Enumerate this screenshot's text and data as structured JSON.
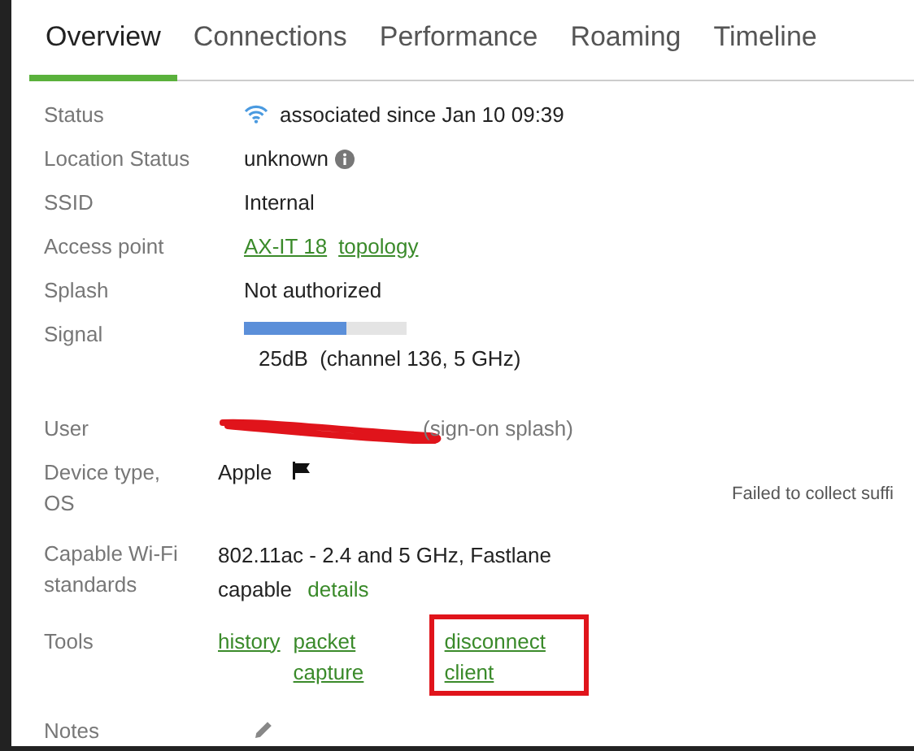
{
  "tabs": [
    {
      "label": "Overview",
      "selected": true
    },
    {
      "label": "Connections",
      "selected": false
    },
    {
      "label": "Performance",
      "selected": false
    },
    {
      "label": "Roaming",
      "selected": false
    },
    {
      "label": "Timeline",
      "selected": false
    }
  ],
  "rows": [
    {
      "kind": "status",
      "label": "Status",
      "value": "associated since Jan 10 09:39"
    },
    {
      "kind": "info",
      "label": "Location Status",
      "value": "unknown"
    },
    {
      "kind": "text",
      "label": "SSID",
      "value": "Internal"
    },
    {
      "kind": "links",
      "label": "Access point",
      "links": [
        "AX-IT 18",
        "topology"
      ]
    },
    {
      "kind": "text",
      "label": "Splash",
      "value": "Not authorized"
    },
    {
      "kind": "signal",
      "label": "Signal",
      "level": 0.63,
      "value": "25dB  (channel 136, 5 GHz)"
    },
    {
      "kind": "redacted",
      "label": "User",
      "value": "(sign-on splash)"
    },
    {
      "kind": "device",
      "label": "Device type, OS",
      "value": "Apple",
      "note": "Failed to collect suffi"
    },
    {
      "kind": "capable",
      "label": "Capable Wi-Fi standards",
      "value": "802.11ac - 2.4 and 5 GHz, Fastlane capable",
      "link": "details"
    },
    {
      "kind": "tools",
      "label": "Tools",
      "links": [
        {
          "label": "history",
          "highlighted": false
        },
        {
          "label": "packet capture",
          "highlighted": false
        },
        {
          "label": "disconnect client",
          "highlighted": true
        }
      ]
    },
    {
      "kind": "notes",
      "label": "Notes"
    }
  ]
}
